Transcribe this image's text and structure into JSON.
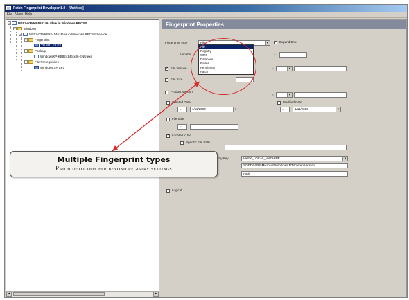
{
  "window": {
    "title": "Patch Fingerprint Developer 8.0 - [Untitled]"
  },
  "menubar": [
    "File",
    "View",
    "Help"
  ],
  "tree": {
    "root": "MS03-039 KB824146: Flaw in Windows RPCSS",
    "nodes": [
      {
        "label": "Windows",
        "icon": "folder-icon"
      },
      {
        "label": "MS03-039 KB824146: Flaw in Windows RPCSS Service",
        "icon": "document-icon"
      },
      {
        "label": "Fingerprint",
        "icon": "folder-icon"
      },
      {
        "label": "XP SP1 FILES",
        "icon": "fingerprint-icon",
        "selected": true
      },
      {
        "label": "Package",
        "icon": "folder-icon"
      },
      {
        "label": "WindowsXP-KB824146-x86-ENU.exe",
        "icon": "package-icon"
      },
      {
        "label": "File Prerequisites",
        "icon": "folder-icon"
      },
      {
        "label": "Windows XP SP1",
        "icon": "fingerprint-icon"
      }
    ]
  },
  "panel": {
    "title": "Fingerprint Properties",
    "fingerprint_type_label": "Fingerprint Type",
    "fingerprint_type_value": "File",
    "expand_env_label": "Expand Env.",
    "variable_label": "Variable",
    "file_version_label": "File Version",
    "file_size_label": "File Size",
    "product_version_label": "Product Version",
    "created_date_label": "Created Date",
    "modified_date_label": "Modified Date",
    "date1": "1/11/2003",
    "date2": "1/11/2003",
    "file_size_chk_label": "File Size",
    "located_label": "Located in file",
    "specific_path_label": "Specific File Path",
    "registry_label": "Registry Key",
    "registry_key": "HKEY_LOCAL_MACHINE",
    "registry_path": "SOFTWARE\\Microsoft\\Windows NT\\CurrentVersion",
    "registry_value": "Path",
    "logical_label": "Logical",
    "ops": [
      "=",
      "="
    ]
  },
  "dropdown": {
    "items": [
      "File",
      "Registry",
      "WMI",
      "Database",
      "Folder",
      "Permission",
      "Patch"
    ],
    "highlighted": 0
  },
  "callout": {
    "heading": "Multiple Fingerprint types",
    "subtext": "Patch detection far beyond registry settings"
  },
  "colors": {
    "annotation": "#d62a2a",
    "selection": "#0a246a",
    "panel_title": "#848b9c"
  }
}
